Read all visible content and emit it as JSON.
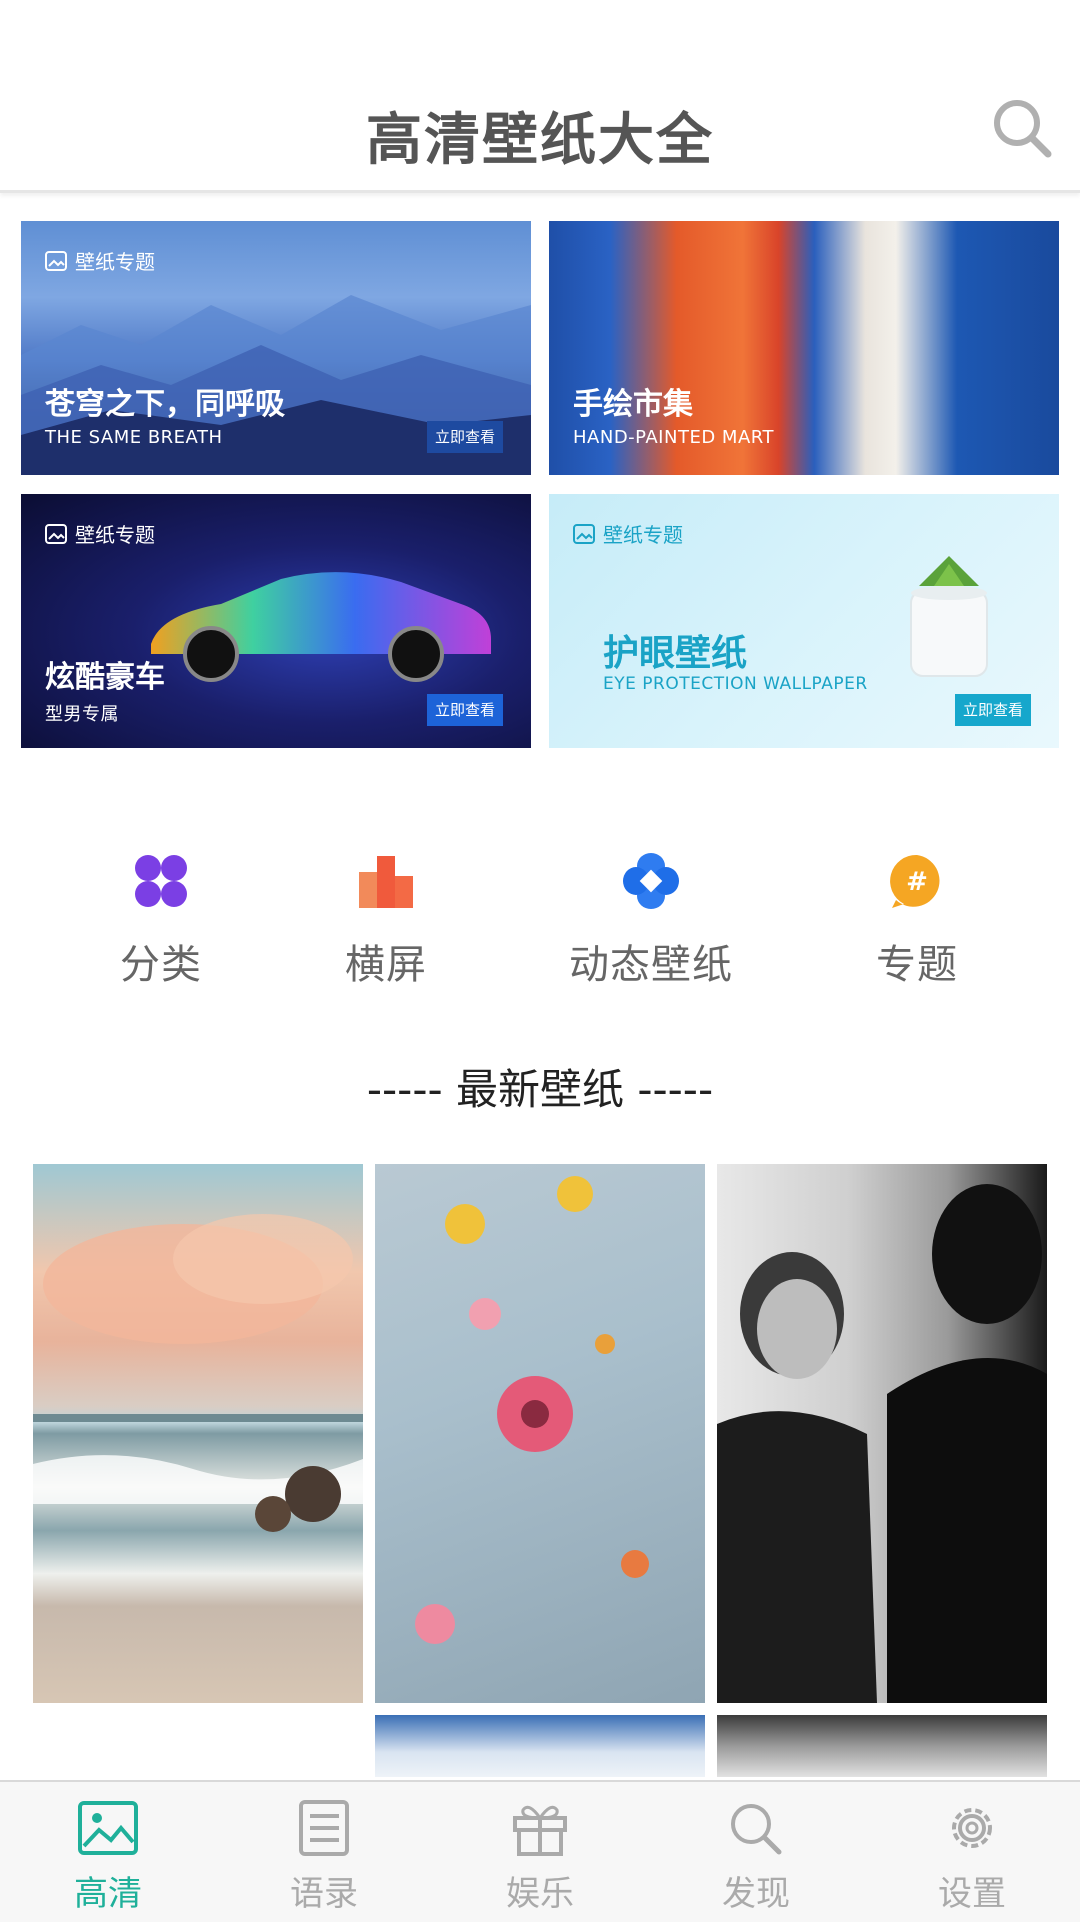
{
  "header": {
    "title": "高清壁纸大全"
  },
  "banners": [
    {
      "tag": "壁纸专题",
      "title": "苍穹之下，同呼吸",
      "subtitle": "THE SAME BREATH",
      "button": "立即查看"
    },
    {
      "tag": "",
      "title": "手绘市集",
      "subtitle": "HAND-PAINTED MART",
      "button": ""
    },
    {
      "tag": "壁纸专题",
      "title": "炫酷豪车",
      "subtitle": "型男专属",
      "button": "立即查看"
    },
    {
      "tag": "壁纸专题",
      "title": "护眼壁纸",
      "subtitle": "EYE PROTECTION WALLPAPER",
      "button": "立即查看"
    }
  ],
  "categories": [
    {
      "label": "分类",
      "icon": "four-petal-icon",
      "color": "#7b3fe4"
    },
    {
      "label": "横屏",
      "icon": "bar-blocks-icon",
      "color": "#f05a3c"
    },
    {
      "label": "动态壁纸",
      "icon": "blue-flower-icon",
      "color": "#1f6ee8"
    },
    {
      "label": "专题",
      "icon": "hash-badge-icon",
      "color": "#f5a623"
    }
  ],
  "section_title": "----- 最新壁纸 -----",
  "bottom_nav": [
    {
      "label": "高清",
      "icon": "image-icon",
      "active": true
    },
    {
      "label": "语录",
      "icon": "list-doc-icon",
      "active": false
    },
    {
      "label": "娱乐",
      "icon": "gift-icon",
      "active": false
    },
    {
      "label": "发现",
      "icon": "search-icon",
      "active": false
    },
    {
      "label": "设置",
      "icon": "gear-icon",
      "active": false
    }
  ],
  "colors": {
    "accent": "#1fb09a",
    "inactive": "#aaaaaa"
  }
}
